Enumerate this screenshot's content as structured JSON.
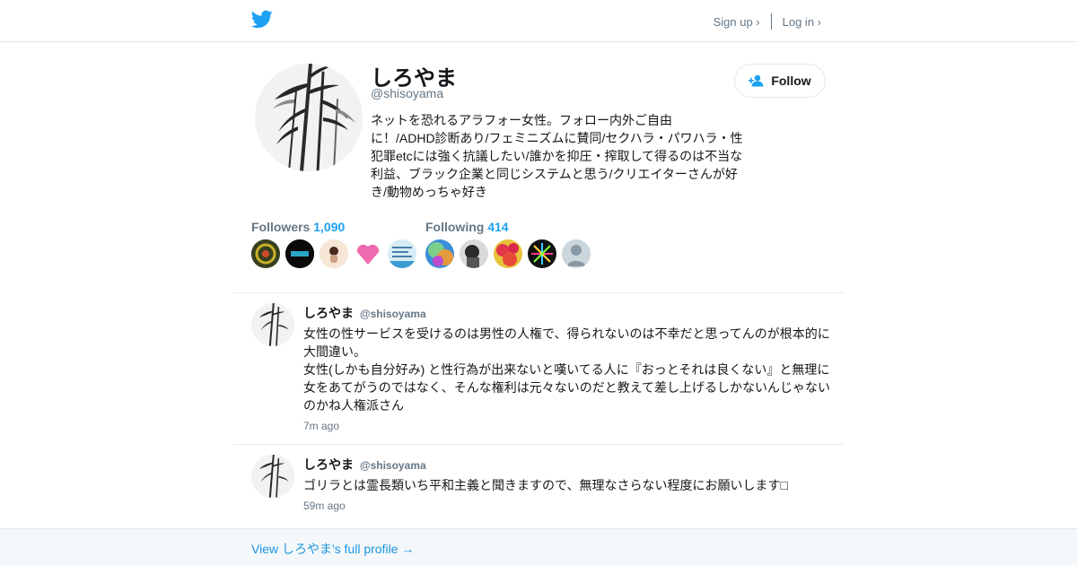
{
  "colors": {
    "accent": "#1da1f2",
    "link": "#1b95e0",
    "muted": "#657786",
    "text": "#14171a",
    "border": "#e6ecf0"
  },
  "header": {
    "logo_icon": "twitter-bird-icon",
    "signup": "Sign up ›",
    "login": "Log in ›"
  },
  "profile": {
    "name": "しろやま",
    "handle": "@shisoyama",
    "bio": "ネットを恐れるアラフォー女性。フォロー内外ご自由\nに！/ADHD診断あり/フェミニズムに賛同/セクハラ・パワハラ・性\n犯罪etcには強く抗議したい/誰かを抑圧・搾取して得るのは不当な\n利益、ブラック企業と同じシステムと思う/クリエイターさんが好\nき/動物めっちゃ好き",
    "follow_label": "Follow",
    "follow_icon": "add-person-icon"
  },
  "stats": {
    "followers": {
      "label": "Followers",
      "count": "1,090"
    },
    "following": {
      "label": "Following",
      "count": "414"
    }
  },
  "tweets": [
    {
      "name": "しろやま",
      "handle": "@shisoyama",
      "text": "女性の性サービスを受けるのは男性の人権で、得られないのは不幸だと思ってんのが根本的に\n大間違い。\n女性(しかも自分好み) と性行為が出来ないと嘆いてる人に『おっとそれは良くない』と無理に\n女をあてがうのではなく、そんな権利は元々ないのだと教えて差し上げるしかないんじゃない\nのかね人権派さん",
      "time": "7m ago"
    },
    {
      "name": "しろやま",
      "handle": "@shisoyama",
      "text": "ゴリラとは霊長類いち平和主義と聞きますので、無理なさらない程度にお願いします□",
      "time": "59m ago"
    }
  ],
  "footer": {
    "link": "View しろやま's full profile →"
  }
}
